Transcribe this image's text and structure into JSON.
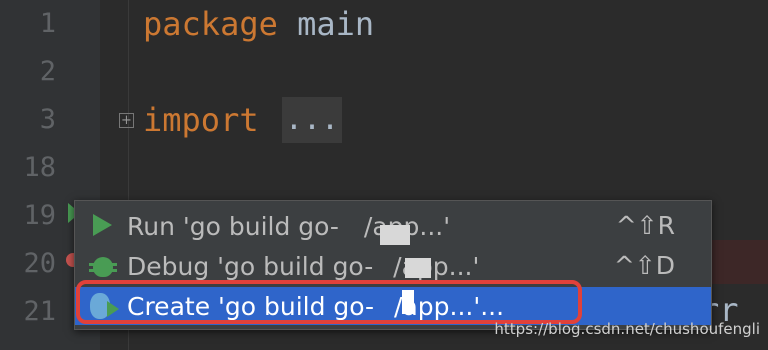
{
  "editor": {
    "line_numbers": [
      "1",
      "2",
      "3",
      "18",
      "19",
      "20",
      "21"
    ],
    "line1_keyword": "package",
    "line1_name": "main",
    "line3_keyword": "import",
    "line3_folded": "...",
    "fold_symbol": "+",
    "tail_fragment": "rr"
  },
  "popup": {
    "items": [
      {
        "label": "Run 'go build go-     /app...'",
        "shortcut": "^⇧R",
        "icon": "run-icon"
      },
      {
        "label": "Debug 'go build go-    /app...'",
        "shortcut": "^⇧D",
        "icon": "debug-icon"
      },
      {
        "label": "Create 'go build go-    /app...'...",
        "shortcut": "",
        "icon": "gopher-icon"
      }
    ]
  },
  "watermark": "https://blog.csdn.net/chushoufengli",
  "colors": {
    "background": "#2b2b2b",
    "keyword": "#cc7832",
    "selection": "#2f65ca",
    "highlight": "#e0413a"
  }
}
